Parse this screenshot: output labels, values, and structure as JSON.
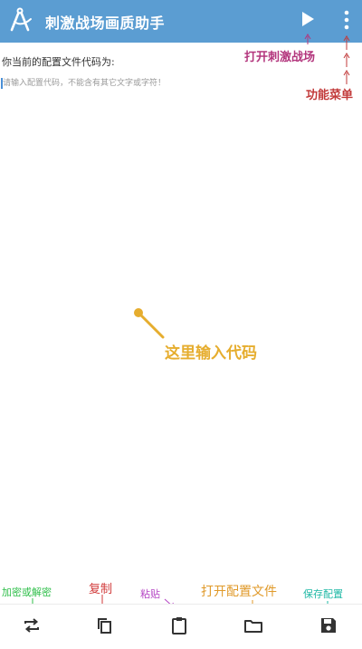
{
  "header": {
    "title": "刺激战场画质助手",
    "logo_icon": "compass-icon",
    "play_icon": "play-icon",
    "menu_icon": "more-vert-icon",
    "background_color": "#5b9dd2"
  },
  "content": {
    "label": "你当前的配置文件代码为:",
    "input_placeholder": "请输入配置代码，不能含有其它文字或字符！",
    "input_value": ""
  },
  "annotations": {
    "open_game": "打开刺激战场",
    "function_menu": "功能菜单",
    "input_here": "这里输入代码",
    "encrypt_decrypt": "加密或解密",
    "copy": "复制",
    "paste": "粘贴",
    "open_config_file": "打开配置文件",
    "save_config": "保存配置"
  },
  "toolbar": {
    "buttons": [
      {
        "icon": "swap-icon",
        "action": "encrypt-decrypt"
      },
      {
        "icon": "copy-icon",
        "action": "copy"
      },
      {
        "icon": "clipboard-icon",
        "action": "paste"
      },
      {
        "icon": "folder-icon",
        "action": "open-config-file"
      },
      {
        "icon": "save-icon",
        "action": "save-config"
      }
    ]
  }
}
